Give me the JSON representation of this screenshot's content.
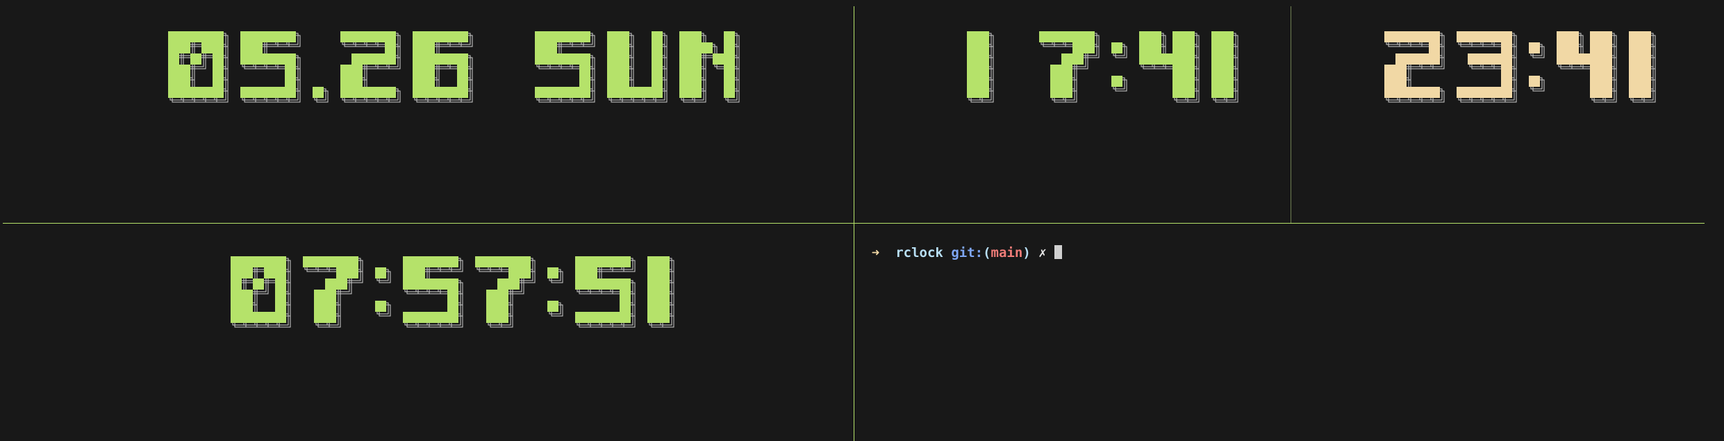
{
  "colors": {
    "background": "#181818",
    "clock_green": "#b5e26a",
    "clock_amber": "#f1d8a5",
    "shadow": "#cfcfcf",
    "divider": "#b5e26a",
    "arrow": "#f1d8a5",
    "dir": "#b8dff5",
    "git_label": "#7ea6f3",
    "branch": "#f07c78",
    "paren": "#b8dff5",
    "dirty": "#e8e8e8",
    "cursor": "#d0d0d0"
  },
  "clocks": {
    "date": {
      "text": "05.26 SUN",
      "color": "clock_green"
    },
    "time_local": {
      "text": "17:41",
      "color": "clock_green"
    },
    "time_other": {
      "text": "23:41",
      "color": "clock_amber"
    },
    "stopwatch": {
      "text": "07:57:51",
      "color": "clock_green"
    }
  },
  "terminal": {
    "arrow": "➜",
    "dir": "rclock",
    "git_label": "git:",
    "paren_open": "(",
    "branch": "main",
    "paren_close": ")",
    "dirty": "✗"
  }
}
